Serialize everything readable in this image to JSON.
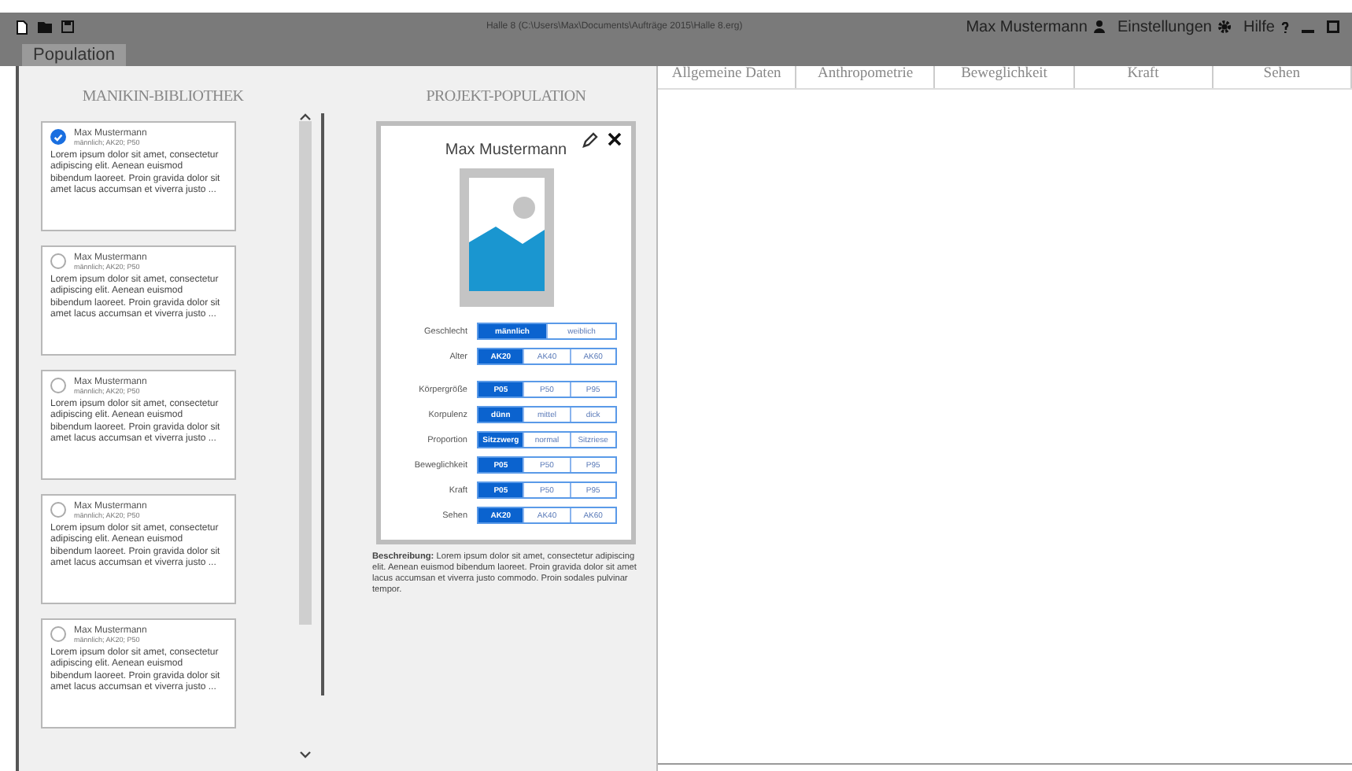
{
  "toolbar": {
    "document_title": "Halle 8 (C:\\Users\\Max\\Documents\\Aufträge 2015\\Halle 8.erg)",
    "user": "Max Mustermann",
    "settings": "Einstellungen",
    "help": "Hilfe"
  },
  "tabs": [
    {
      "label": "Population",
      "selected": true
    }
  ],
  "library": {
    "title": "MANIKIN-BIBLIOTHEK",
    "items": [
      {
        "name": "Max Mustermann",
        "details": "männlich; AK20; P50",
        "text": "Lorem ipsum dolor sit amet, consectetur adipiscing elit. Aenean euismod bibendum laoreet. Proin gravida dolor sit amet lacus accumsan et viverra justo ...",
        "selected": true
      },
      {
        "name": "Max Mustermann",
        "details": "männlich; AK20; P50",
        "text": "Lorem ipsum dolor sit amet, consectetur adipiscing elit. Aenean euismod bibendum laoreet. Proin gravida dolor sit amet lacus accumsan et viverra justo ...",
        "selected": false
      },
      {
        "name": "Max Mustermann",
        "details": "männlich; AK20; P50",
        "text": "Lorem ipsum dolor sit amet, consectetur adipiscing elit. Aenean euismod bibendum laoreet. Proin gravida dolor sit amet lacus accumsan et viverra justo ...",
        "selected": false
      },
      {
        "name": "Max Mustermann",
        "details": "männlich; AK20; P50",
        "text": "Lorem ipsum dolor sit amet, consectetur adipiscing elit. Aenean euismod bibendum laoreet. Proin gravida dolor sit amet lacus accumsan et viverra justo ...",
        "selected": false
      },
      {
        "name": "Max Mustermann",
        "details": "männlich; AK20; P50",
        "text": "Lorem ipsum dolor sit amet, consectetur adipiscing elit. Aenean euismod bibendum laoreet. Proin gravida dolor sit amet lacus accumsan et viverra justo ...",
        "selected": false
      }
    ]
  },
  "project": {
    "title": "PROJEKT-POPULATION",
    "card": {
      "name": "Max Mustermann",
      "parameter_groups": [
        [
          {
            "label": "Geschlecht",
            "options": [
              {
                "label": "männlich",
                "selected": true
              },
              {
                "label": "weiblich",
                "selected": false
              }
            ]
          },
          {
            "label": "Alter",
            "options": [
              {
                "label": "AK20",
                "selected": true
              },
              {
                "label": "AK40",
                "selected": false
              },
              {
                "label": "AK60",
                "selected": false
              }
            ]
          }
        ],
        [
          {
            "label": "Körpergröße",
            "options": [
              {
                "label": "P05",
                "selected": true
              },
              {
                "label": "P50",
                "selected": false
              },
              {
                "label": "P95",
                "selected": false
              }
            ]
          },
          {
            "label": "Korpulenz",
            "options": [
              {
                "label": "dünn",
                "selected": true
              },
              {
                "label": "mittel",
                "selected": false
              },
              {
                "label": "dick",
                "selected": false
              }
            ]
          },
          {
            "label": "Proportion",
            "options": [
              {
                "label": "Sitzzwerg",
                "selected": true
              },
              {
                "label": "normal",
                "selected": false
              },
              {
                "label": "Sitzriese",
                "selected": false
              }
            ]
          },
          {
            "label": "Beweglichkeit",
            "options": [
              {
                "label": "P05",
                "selected": true
              },
              {
                "label": "P50",
                "selected": false
              },
              {
                "label": "P95",
                "selected": false
              }
            ]
          },
          {
            "label": "Kraft",
            "options": [
              {
                "label": "P05",
                "selected": true
              },
              {
                "label": "P50",
                "selected": false
              },
              {
                "label": "P95",
                "selected": false
              }
            ]
          },
          {
            "label": "Sehen",
            "options": [
              {
                "label": "AK20",
                "selected": true
              },
              {
                "label": "AK40",
                "selected": false
              },
              {
                "label": "AK60",
                "selected": false
              }
            ]
          }
        ]
      ]
    },
    "description": "**Beschreibung:** Lorem ipsum dolor sit amet, consectetur adipiscing elit. Aenean euismod bibendum laoreet. Proin gravida dolor sit amet lacus accumsan et viverra justo commodo. Proin sodales pulvinar tempor."
  },
  "detail_tabs": [
    "Allgemeine Daten",
    "Anthropometrie",
    "Beweglichkeit",
    "Kraft",
    "Sehen"
  ]
}
